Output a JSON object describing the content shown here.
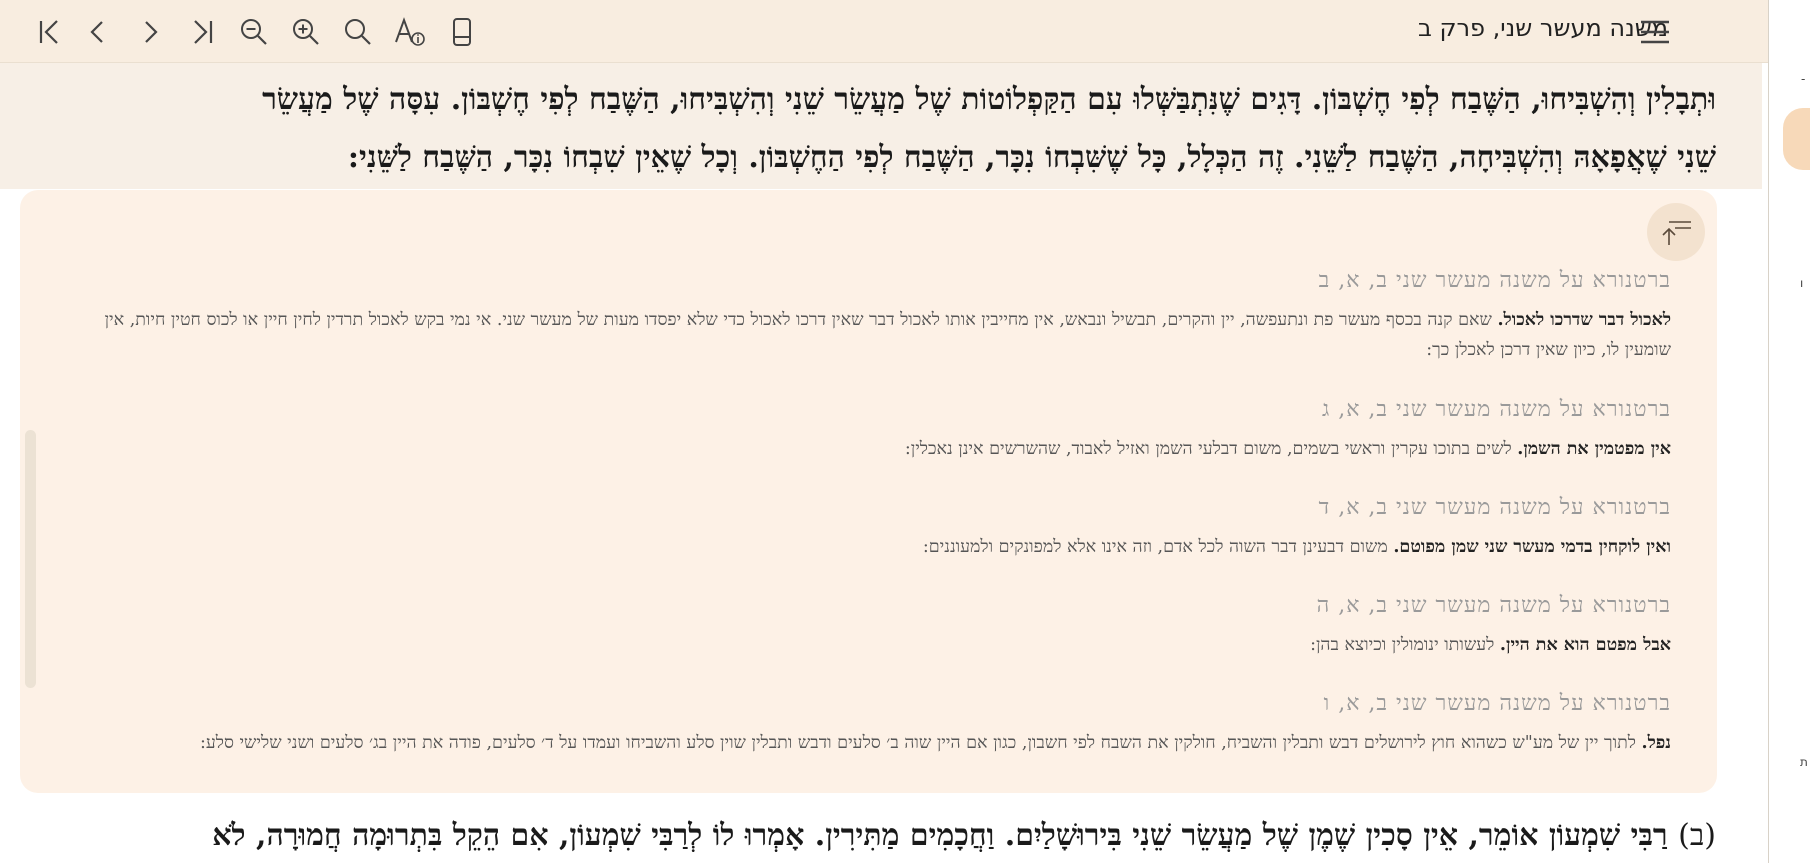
{
  "toolbar": {
    "title": "משנה מעשר שני, פרק ב",
    "buttons": [
      "first-page-icon",
      "prev-page-icon",
      "next-page-icon",
      "last-page-icon",
      "zoom-out-icon",
      "zoom-in-icon",
      "search-icon",
      "font-settings-icon",
      "layout-icon"
    ]
  },
  "mishna_top": {
    "line1": "וּתְבָלִין וְהִשְׁבִּיחוּ, הַשֶּׁבַח לְפִי חֶשְׁבּוֹן. דָּגִים שֶׁנִּתְבַּשְּׁלוּ עִם הַקַּפְלוֹטוֹת שֶׁל מַעֲשֵׂר שֵׁנִי וְהִשְׁבִּיחוּ, הַשֶּׁבַח לְפִי חֶשְׁבּוֹן. עִסָּה שֶׁל מַעֲשֵׂר",
    "line2": "שֵׁנִי שֶׁאֲפָאָהּ וְהִשְׁבִּיחָה, הַשֶּׁבַח לַשֵּׁנִי. זֶה הַכְּלָל, כָּל שֶׁשִּׁבְחוֹ נִכָּר, הַשֶּׁבַח לְפִי הַחֶשְׁבּוֹן. וְכָל שֶׁאֵין שִׁבְחוֹ נִכָּר, הַשֶּׁבַח לַשֵּׁנִי:"
  },
  "commentary": [
    {
      "ref": "ברטנורא על משנה מעשר שני ב, א, ב",
      "head": "לאכול דבר שדרכו לאכול.",
      "text": " שאם קנה בכסף מעשר פת ונתעפשה, יין והקרים, תבשיל ונבאש, אין מחייבין אותו לאכול דבר שאין דרכו לאכול כדי שלא יפסדו מעות של מעשר שני. אי נמי בקש לאכול תרדין לחין חיין או לכוס חטין חיות, אין שומעין לו, כיון שאין דרכן לאכלן כך:"
    },
    {
      "ref": "ברטנורא על משנה מעשר שני ב, א, ג",
      "head": "אין מפטמין את השמן.",
      "text": " לשים בתוכו עקרין וראשי בשמים, משום דבלעי השמן ואזיל לאבוד, שהשרשים אינן נאכלין:"
    },
    {
      "ref": "ברטנורא על משנה מעשר שני ב, א, ד",
      "head": "ואין לוקחין בדמי מעשר שני שמן מפוטם.",
      "text": " משום דבעינן דבר השוה לכל אדם, וזה אינו אלא למפונקים ולמעוננים:"
    },
    {
      "ref": "ברטנורא על משנה מעשר שני ב, א, ה",
      "head": "אבל מפטם הוא את היין.",
      "text": " לעשותו ינומולין וכיוצא בהן:"
    },
    {
      "ref": "ברטנורא על משנה מעשר שני ב, א, ו",
      "head": "נפל.",
      "text": " לתוך יין של מע\"ש כשהוא חוץ לירושלים דבש ותבלין והשביח, חולקין את השבח לפי חשבון, כגון אם היין שוה ב׳ סלעים ודבש ותבלין שוין סלע והשביחו ועמדו על ד׳ סלעים, פודה את היין בג׳ סלעים ושני שלישי סלע:"
    }
  ],
  "mishna_bottom": {
    "number": "(ב)",
    "text": "רַבִּי שִׁמְעוֹן אוֹמֵר, אֵין סָכִין שֶׁמֶן שֶׁל מַעֲשֵׂר שֵׁנִי בִּירוּשָׁלַיִם. וַחֲכָמִים מַתִּירִין. אָמְרוּ לוֹ לְרַבִּי שִׁמְעוֹן, אִם הֵקֵל בִּתְרוּמָה חֲמוּרָה, לֹא"
  },
  "side_marks": [
    "-",
    "ו",
    "ת"
  ]
}
